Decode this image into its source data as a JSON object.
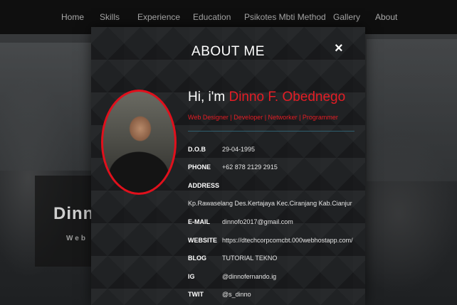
{
  "nav": {
    "items": [
      "Home",
      "Skills",
      "Experience",
      "Education",
      "Psikotes Mbti Method",
      "Gallery",
      "About"
    ]
  },
  "hero": {
    "name": "Dinn",
    "subtitle": "Web De"
  },
  "modal": {
    "title": "ABOUT ME",
    "close_label": "×",
    "greeting_prefix": "Hi, i'm ",
    "greeting_name": "Dinno F. Obednego",
    "roles": "Web Designer | Developer | Networker | Programmer",
    "fields": {
      "dob": {
        "label": "D.O.B",
        "value": "29-04-1995"
      },
      "phone": {
        "label": "PHONE",
        "value": "+62 878 2129 2915"
      },
      "address": {
        "label": "ADDRESS",
        "value": "Kp.Rawaselang Des.Kertajaya Kec.Ciranjang Kab.Cianjur"
      },
      "email": {
        "label": "E-MAIL",
        "value": "dinnofo2017@gmail.com"
      },
      "website": {
        "label": "WEBSITE",
        "value": "https://dtechcorpcomcbt.000webhostapp.com/"
      },
      "blog": {
        "label": "BLOG",
        "value": "TUTORIAL TEKNO"
      },
      "ig": {
        "label": "IG",
        "value": "@dinnofernando.ig"
      },
      "twit": {
        "label": "TWIT",
        "value": "@s_dinno"
      }
    }
  },
  "colors": {
    "accent": "#e41d25",
    "divider": "#2f5f6f",
    "nav_bg": "#0e0e0e",
    "modal_bg": "#202224"
  }
}
